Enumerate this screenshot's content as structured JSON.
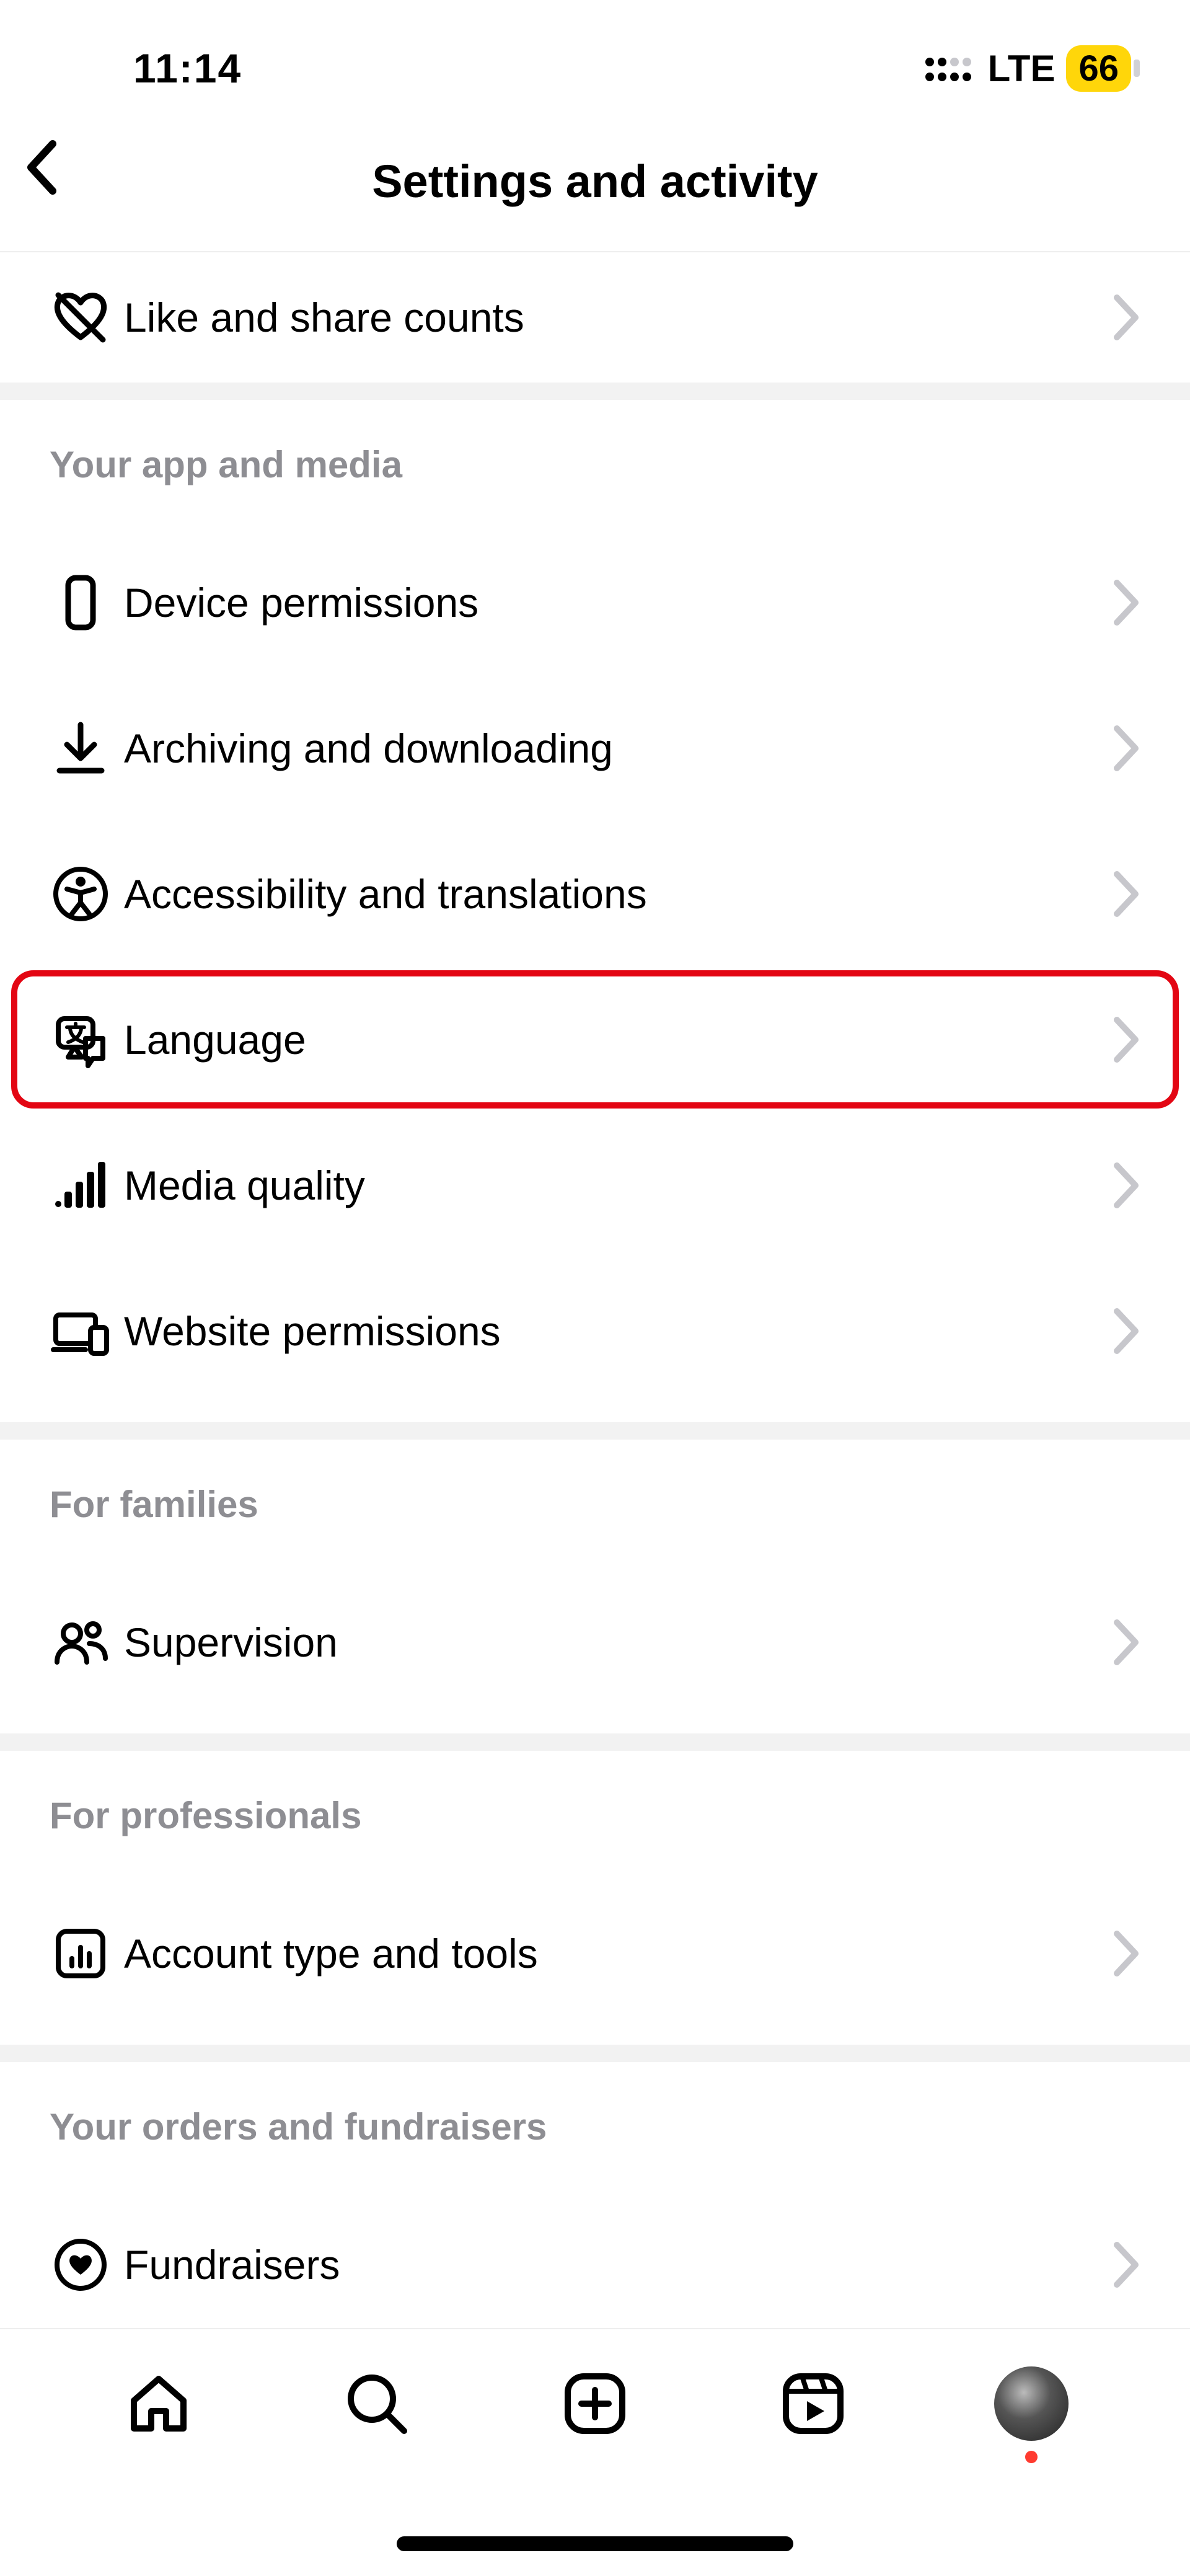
{
  "status": {
    "time": "11:14",
    "network": "LTE",
    "battery": "66"
  },
  "header": {
    "title": "Settings and activity"
  },
  "top_row": {
    "label": "Like and share counts"
  },
  "sections": [
    {
      "header": "Your app and media",
      "items": [
        {
          "label": "Device permissions"
        },
        {
          "label": "Archiving and downloading"
        },
        {
          "label": "Accessibility and translations"
        },
        {
          "label": "Language",
          "highlight": true
        },
        {
          "label": "Media quality"
        },
        {
          "label": "Website permissions"
        }
      ]
    },
    {
      "header": "For families",
      "items": [
        {
          "label": "Supervision"
        }
      ]
    },
    {
      "header": "For professionals",
      "items": [
        {
          "label": "Account type and tools"
        }
      ]
    },
    {
      "header": "Your orders and fundraisers",
      "items": [
        {
          "label": "Fundraisers"
        }
      ]
    }
  ]
}
